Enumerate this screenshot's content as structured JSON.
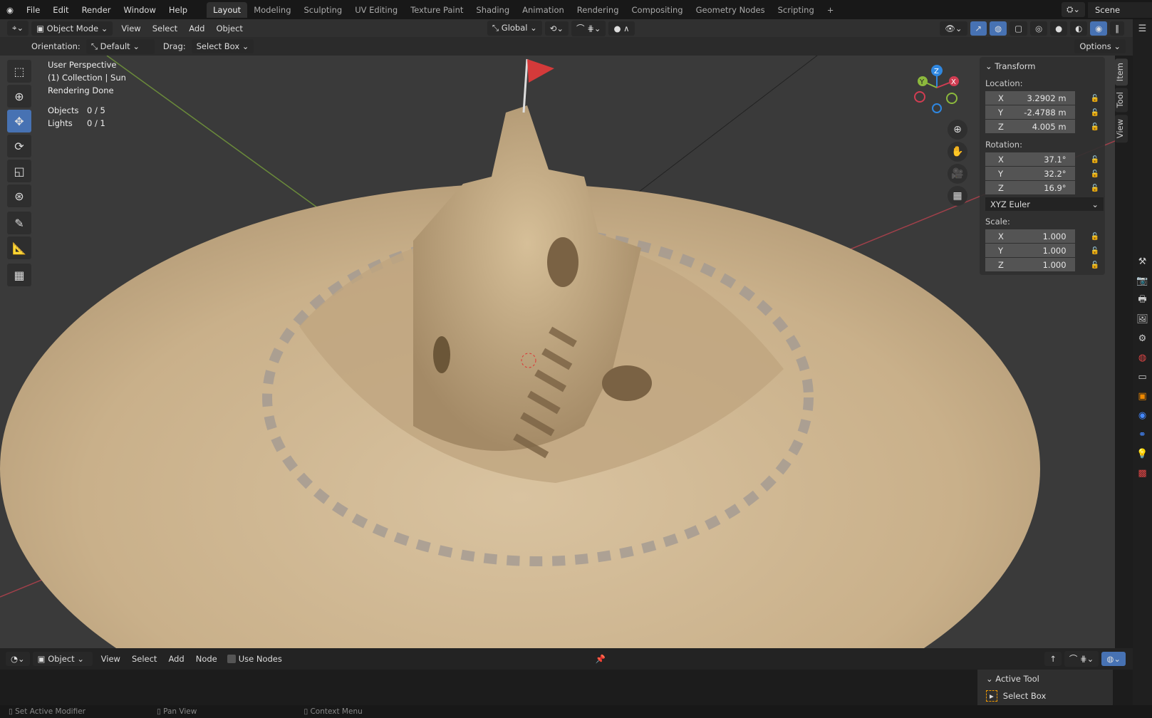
{
  "menu": [
    "File",
    "Edit",
    "Render",
    "Window",
    "Help"
  ],
  "workspaces": [
    "Layout",
    "Modeling",
    "Sculpting",
    "UV Editing",
    "Texture Paint",
    "Shading",
    "Animation",
    "Rendering",
    "Compositing",
    "Geometry Nodes",
    "Scripting"
  ],
  "scene": "Scene",
  "header": {
    "mode": "Object Mode",
    "menus": [
      "View",
      "Select",
      "Add",
      "Object"
    ],
    "transform_orientation": "Global"
  },
  "tool_options": {
    "orientation_label": "Orientation:",
    "orientation": "Default",
    "drag_label": "Drag:",
    "drag": "Select Box",
    "options": "Options"
  },
  "viewport_info": {
    "perspective": "User Perspective",
    "collection": "(1) Collection | Sun",
    "status": "Rendering Done",
    "objects_label": "Objects",
    "objects": "0 / 5",
    "lights_label": "Lights",
    "lights": "0 / 1"
  },
  "gizmo": {
    "x": "X",
    "y": "Y",
    "z": "Z"
  },
  "transform": {
    "title": "Transform",
    "location_label": "Location:",
    "location": [
      {
        "axis": "X",
        "value": "3.2902 m"
      },
      {
        "axis": "Y",
        "value": "-2.4788 m"
      },
      {
        "axis": "Z",
        "value": "4.005 m"
      }
    ],
    "rotation_label": "Rotation:",
    "rotation": [
      {
        "axis": "X",
        "value": "37.1°"
      },
      {
        "axis": "Y",
        "value": "32.2°"
      },
      {
        "axis": "Z",
        "value": "16.9°"
      }
    ],
    "rotation_mode": "XYZ Euler",
    "scale_label": "Scale:",
    "scale": [
      {
        "axis": "X",
        "value": "1.000"
      },
      {
        "axis": "Y",
        "value": "1.000"
      },
      {
        "axis": "Z",
        "value": "1.000"
      }
    ]
  },
  "sidebar_tabs": [
    "Item",
    "Tool",
    "View"
  ],
  "node_editor": {
    "type": "Object",
    "menus": [
      "View",
      "Select",
      "Add",
      "Node"
    ],
    "use_nodes": "Use Nodes",
    "active_tool_title": "Active Tool",
    "active_tool": "Select Box"
  },
  "statusbar": [
    "Set Active Modifier",
    "Pan View",
    "Context Menu"
  ],
  "colors": {
    "accent": "#4772b3",
    "x_axis": "#d13d52",
    "y_axis": "#8cb93d",
    "z_axis": "#2f87e0"
  }
}
